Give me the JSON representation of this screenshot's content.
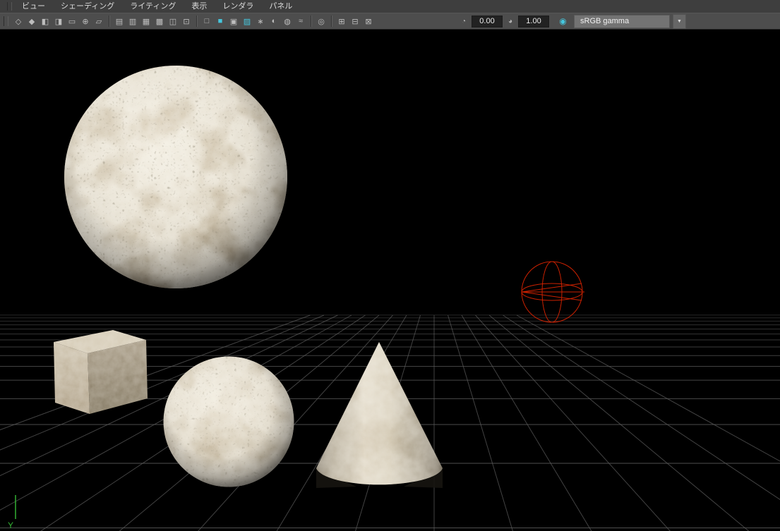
{
  "menu_bar": {
    "items": [
      {
        "id": "view",
        "label": "ビュー"
      },
      {
        "id": "shading",
        "label": "シェーディング"
      },
      {
        "id": "lighting",
        "label": "ライティング"
      },
      {
        "id": "show",
        "label": "表示"
      },
      {
        "id": "renderer",
        "label": "レンダラ"
      },
      {
        "id": "panels",
        "label": "パネル"
      }
    ]
  },
  "toolbar": {
    "groups": [
      [
        {
          "name": "select-camera-icon",
          "glyph": "◇"
        },
        {
          "name": "lock-camera-icon",
          "glyph": "◆"
        },
        {
          "name": "camera-attributes-icon",
          "glyph": "◧"
        },
        {
          "name": "bookmarks-icon",
          "glyph": "◨"
        },
        {
          "name": "image-plane-icon",
          "glyph": "▭"
        },
        {
          "name": "two-d-pan-zoom-icon",
          "glyph": "⊕"
        },
        {
          "name": "grease-pencil-icon",
          "glyph": "▱"
        }
      ],
      [
        {
          "name": "film-gate-icon",
          "glyph": "▤"
        },
        {
          "name": "resolution-gate-icon",
          "glyph": "▥"
        },
        {
          "name": "gate-mask-icon",
          "glyph": "▦"
        },
        {
          "name": "field-chart-icon",
          "glyph": "▩"
        },
        {
          "name": "safe-action-icon",
          "glyph": "◫"
        },
        {
          "name": "safe-title-icon",
          "glyph": "⊡"
        }
      ],
      [
        {
          "name": "wireframe-icon",
          "glyph": "□"
        },
        {
          "name": "smooth-shade-icon",
          "glyph": "■",
          "color": "#45c6dd"
        },
        {
          "name": "wireframe-on-shaded-icon",
          "glyph": "▣"
        },
        {
          "name": "textured-icon",
          "glyph": "▨",
          "color": "#45c6dd"
        },
        {
          "name": "use-all-lights-icon",
          "glyph": "∗"
        },
        {
          "name": "shadows-icon",
          "glyph": "◐"
        },
        {
          "name": "occlusion-icon",
          "glyph": "◍"
        },
        {
          "name": "anti-alias-icon",
          "glyph": "≈"
        }
      ],
      [
        {
          "name": "isolate-select-icon",
          "glyph": "◎"
        }
      ],
      [
        {
          "name": "frame-buffer-icon",
          "glyph": "⊞"
        },
        {
          "name": "snapshot-icon",
          "glyph": "⊟"
        },
        {
          "name": "image-overlay-icon",
          "glyph": "⊠"
        }
      ]
    ],
    "controls": {
      "exposure_icon_glyph": "◔",
      "gamma_icon_glyph": "◕",
      "color_mgmt_glyph": "◉",
      "dropdown_arrow": "▼"
    },
    "exposure_value": "0.00",
    "gamma_value": "1.00",
    "view_transform_label": "sRGB gamma"
  },
  "viewport": {
    "axis_label": "Y"
  },
  "colors": {
    "accent_cyan": "#45c6dd",
    "light_wireframe_red": "#cc2100",
    "grid_line": "#5b5b5b",
    "axis_y_green": "#33b133",
    "viewport_background": "#000000"
  }
}
